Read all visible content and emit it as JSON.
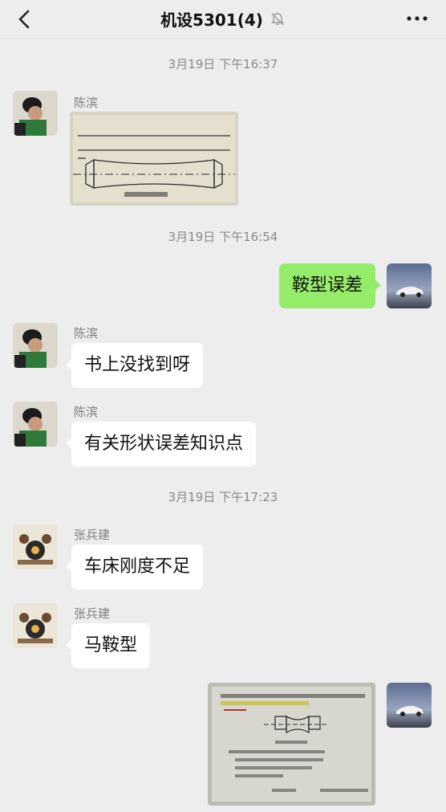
{
  "header": {
    "title": "机设5301(4)",
    "back_icon": "chevron-left-icon",
    "mute_icon": "bell-off-icon",
    "more_icon": "more-dots-icon"
  },
  "timestamps": [
    "3月19日 下午16:37",
    "3月19日 下午16:54",
    "3月19日 下午17:23"
  ],
  "messages": [
    {
      "sender": "陈滨",
      "type": "image",
      "side": "left"
    },
    {
      "sender": "me",
      "type": "text",
      "text": "鞍型误差",
      "side": "right"
    },
    {
      "sender": "陈滨",
      "type": "text",
      "text": "书上没找到呀",
      "side": "left"
    },
    {
      "sender": "陈滨",
      "type": "text",
      "text": "有关形状误差知识点",
      "side": "left"
    },
    {
      "sender": "张兵建",
      "type": "text",
      "text": "车床刚度不足",
      "side": "left"
    },
    {
      "sender": "张兵建",
      "type": "text",
      "text": "马鞍型",
      "side": "left"
    },
    {
      "sender": "me",
      "type": "image",
      "side": "right"
    }
  ],
  "colors": {
    "background": "#ededed",
    "my_bubble": "#95ec69",
    "other_bubble": "#ffffff",
    "meta_text": "#8a8a8a"
  }
}
